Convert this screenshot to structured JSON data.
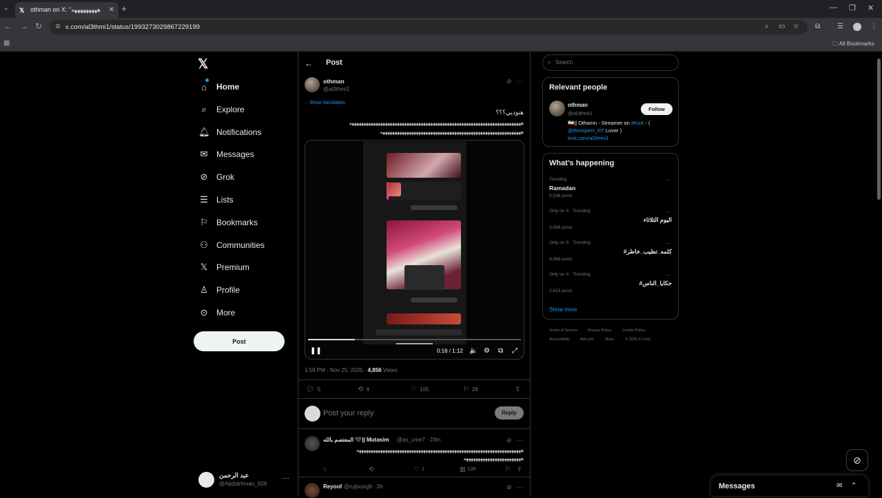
{
  "browser": {
    "tab_title": "othman on X: \"هههههههههه",
    "tab_icon": "x-logo-icon",
    "url": "x.com/al3thmi1/status/1993273029867229199",
    "all_bookmarks": "All Bookmarks"
  },
  "nav": {
    "items": [
      {
        "label": "Home",
        "icon": "home-icon"
      },
      {
        "label": "Explore",
        "icon": "search-icon"
      },
      {
        "label": "Notifications",
        "icon": "bell-icon"
      },
      {
        "label": "Messages",
        "icon": "envelope-icon"
      },
      {
        "label": "Grok",
        "icon": "grok-icon"
      },
      {
        "label": "Lists",
        "icon": "list-icon"
      },
      {
        "label": "Bookmarks",
        "icon": "bookmark-icon"
      },
      {
        "label": "Communities",
        "icon": "people-icon"
      },
      {
        "label": "Premium",
        "icon": "x-logo-icon"
      },
      {
        "label": "Profile",
        "icon": "person-icon"
      },
      {
        "label": "More",
        "icon": "more-circle-icon"
      }
    ],
    "post_button": "Post",
    "account": {
      "name": "عبد الرحمن",
      "handle": "@Abdulrhman_509"
    }
  },
  "post": {
    "header_title": "Post",
    "author_name": "othman",
    "author_handle": "@al3thmi1",
    "show_translation": "Show translation",
    "text_line1": "هنوديي؟؟؟",
    "text_line2": "ههههههههههههههههههههههههههههههههههههههههههههههههههههههههههههههههههههههههه",
    "text_line3": "هههههههههههههههههههههههههههههههههههههههههههههههههههههههههههه",
    "video": {
      "elapsed": "0:16",
      "duration": "1:12",
      "progress": 0.22,
      "clock": "0:16 / 1:12"
    },
    "meta_time": "1:58 PM · Nov 25, 2025 · ",
    "views_count": "4,856",
    "views_label": " Views",
    "stats": {
      "replies": "5",
      "reposts": "4",
      "likes": "105",
      "bookmarks": "28"
    },
    "reply_placeholder": "Post your reply",
    "reply_button": "Reply"
  },
  "replies": [
    {
      "name": "المعتصم بالله 🖤|| Mutasim",
      "handle": "@as_cme7 · 23m",
      "line1": "هههههههههههههههههههههههههههههههههههههههههههههههههههههههههههههههههههههه",
      "line2": "ههههههههههههههههههههههههه",
      "likes": "1",
      "views": "139"
    },
    {
      "name": "Reyoof",
      "handle": "@rujisung9 · 2h",
      "line1": "",
      "line2": "",
      "likes": "",
      "views": ""
    }
  ],
  "sidebar": {
    "search_placeholder": "Search",
    "relevant_title": "Relevant people",
    "person": {
      "name": "othman",
      "handle": "@al3thmi1",
      "follow": "Follow",
      "bio_part1": "🇮🇷|| Othamn - Streamer on ",
      "bio_link1": "#Kick",
      "bio_part2": " - ( ",
      "bio_link2": "@Resspect_RT",
      "bio_part3": " Lover )",
      "bio_link3": "kick.com/al3thmi1"
    },
    "happening_title": "What’s happening",
    "trends": [
      {
        "label": "Trending",
        "name": "Ramadan",
        "count": "5,536 posts"
      },
      {
        "label": "Only on X · Trending",
        "name": "اليوم الثلاثاء",
        "count": "3,598 posts"
      },
      {
        "label": "Only on X · Trending",
        "name": "#كلمه_تطيب_خاطر",
        "count": "4,088 posts"
      },
      {
        "label": "Only on X · Trending",
        "name": "#حكايا_الناس",
        "count": "2,833 posts"
      }
    ],
    "show_more": "Show more",
    "footer": [
      "Terms of Service",
      "Privacy Policy",
      "Cookie Policy",
      "Accessibility",
      "Ads info",
      "More ···",
      "© 2025 X Corp."
    ]
  },
  "messages_drawer": {
    "title": "Messages"
  },
  "colors": {
    "accent": "#1d9bf0",
    "bg": "#000000",
    "text": "#e7e9ea",
    "muted": "#71767b",
    "border": "#2f3336"
  }
}
